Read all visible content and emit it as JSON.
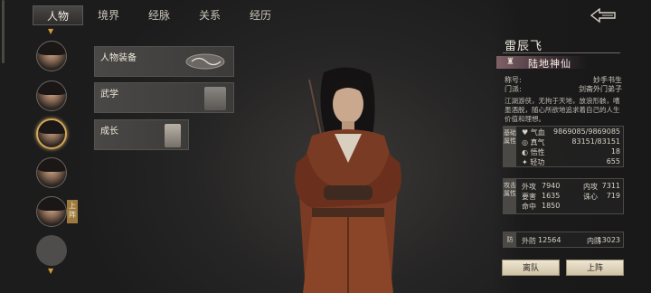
{
  "tabs": [
    {
      "label": "人物",
      "active": true
    },
    {
      "label": "境界",
      "active": false
    },
    {
      "label": "经脉",
      "active": false
    },
    {
      "label": "关系",
      "active": false
    },
    {
      "label": "经历",
      "active": false
    }
  ],
  "roster": {
    "deploy_badge": "上阵",
    "selected_index": 2
  },
  "slots": [
    {
      "label": "人物装备"
    },
    {
      "label": "武学"
    },
    {
      "label": "成长"
    }
  ],
  "character": {
    "name": "雷辰飞",
    "realm": "陆地神仙",
    "nickname_label": "称号:",
    "nickname_value": "妙手书生",
    "sect_label": "门派:",
    "sect_value": "剑斋外门弟子",
    "description": "江湖游侠，无拘于天地，放浪形骸，嗜墨酒脱，随心所欲地追求着自己的人生价值和理想。"
  },
  "base_stats": {
    "section_label": "基础属性",
    "rows": [
      {
        "label": "气血",
        "value": "9869085/9869085"
      },
      {
        "label": "真气",
        "value": "83151/83151"
      },
      {
        "label": "悟性",
        "value": "18"
      },
      {
        "label": "轻功",
        "value": "655"
      }
    ]
  },
  "attack_stats": {
    "section_label": "攻击属性",
    "rows": [
      {
        "label": "外攻",
        "value": "7940",
        "label2": "内攻",
        "value2": "7311"
      },
      {
        "label": "要害",
        "value": "1635",
        "label2": "诛心",
        "value2": "719"
      },
      {
        "label": "命中",
        "value": "1850",
        "label2": "",
        "value2": ""
      }
    ]
  },
  "defense_stats": {
    "section_label": "防",
    "label": "外防",
    "value": "12564",
    "label2": "内防",
    "value2": "13023"
  },
  "buttons": {
    "leave": "离队",
    "deploy": "上阵"
  }
}
